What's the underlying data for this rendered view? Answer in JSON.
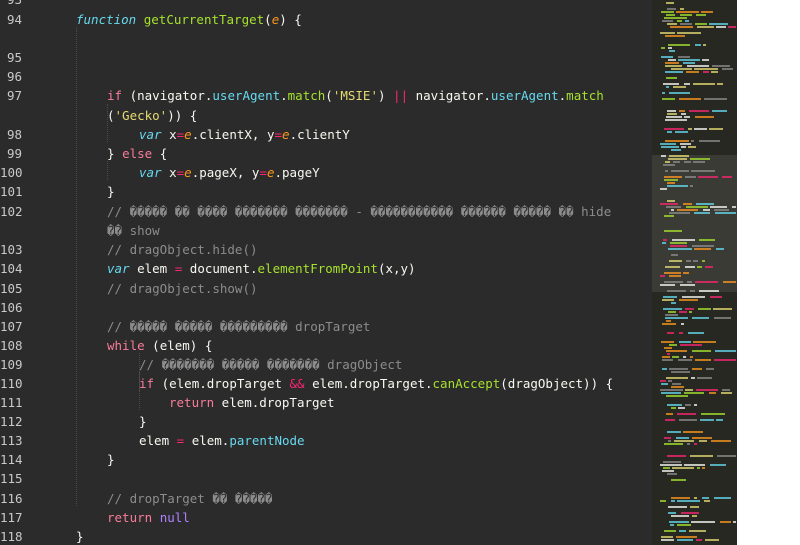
{
  "colors": {
    "background": "#2b2b2b",
    "line_number": "#c9c9c9",
    "keyword": "#f97b9b",
    "storage": "#66d9ef",
    "function": "#a6e22e",
    "parameter": "#fd971f",
    "string": "#e6db74",
    "property": "#66d9ef",
    "operator": "#f92672",
    "comment": "#8c8c8c",
    "text": "#f8f8f2",
    "bracket": "#ffd700",
    "literal": "#ae81ff",
    "minimap_bg": "#272822"
  },
  "line_numbers": [
    "93",
    "94",
    "95",
    "96",
    "97",
    "98",
    "99",
    "100",
    "101",
    "102",
    "103",
    "104",
    "105",
    "106",
    "107",
    "108",
    "109",
    "110",
    "111",
    "112",
    "113",
    "114",
    "115",
    "116",
    "117",
    "118"
  ],
  "code_lines": [
    [],
    [
      {
        "c": "kwi",
        "t": "function"
      },
      {
        "c": "pn",
        "t": " "
      },
      {
        "c": "fn",
        "t": "getCurrentTarget"
      },
      {
        "c": "pn",
        "t": "("
      },
      {
        "c": "prm",
        "t": "e"
      },
      {
        "c": "pn",
        "t": ") {"
      }
    ],
    [],
    [],
    [
      {
        "c": "kw",
        "t": "if"
      },
      {
        "c": "pn",
        "t": " ("
      },
      {
        "c": "pn",
        "t": "navigator."
      },
      {
        "c": "prop",
        "t": "userAgent"
      },
      {
        "c": "pn",
        "t": "."
      },
      {
        "c": "fn",
        "t": "match"
      },
      {
        "c": "pn",
        "t": "("
      },
      {
        "c": "str",
        "t": "'MSIE'"
      },
      {
        "c": "pn",
        "t": ") "
      },
      {
        "c": "op",
        "t": "||"
      },
      {
        "c": "pn",
        "t": " navigator."
      },
      {
        "c": "prop",
        "t": "userAgent"
      },
      {
        "c": "pn",
        "t": "."
      },
      {
        "c": "fn",
        "t": "match"
      }
    ],
    [
      {
        "c": "pn",
        "t": "("
      },
      {
        "c": "str",
        "t": "'Gecko'"
      },
      {
        "c": "pn",
        "t": ")) {"
      }
    ],
    [
      {
        "c": "kwi",
        "t": "var"
      },
      {
        "c": "pn",
        "t": " x"
      },
      {
        "c": "op",
        "t": "="
      },
      {
        "c": "prm",
        "t": "e"
      },
      {
        "c": "pn",
        "t": ".clientX, y"
      },
      {
        "c": "op",
        "t": "="
      },
      {
        "c": "prm",
        "t": "e"
      },
      {
        "c": "pn",
        "t": ".clientY"
      }
    ],
    [
      {
        "c": "pn",
        "t": "} "
      },
      {
        "c": "kw",
        "t": "else"
      },
      {
        "c": "pn",
        "t": " {"
      }
    ],
    [
      {
        "c": "kwi",
        "t": "var"
      },
      {
        "c": "pn",
        "t": " x"
      },
      {
        "c": "op",
        "t": "="
      },
      {
        "c": "prm",
        "t": "e"
      },
      {
        "c": "pn",
        "t": ".pageX, y"
      },
      {
        "c": "op",
        "t": "="
      },
      {
        "c": "prm",
        "t": "e"
      },
      {
        "c": "pn",
        "t": ".pageY"
      }
    ],
    [
      {
        "c": "pn",
        "t": "}"
      }
    ],
    [
      {
        "c": "cm",
        "t": "// ����� �� ���� ������� ������� - ����������� ������ ����� �� hide"
      }
    ],
    [
      {
        "c": "cm",
        "t": "�� show"
      }
    ],
    [
      {
        "c": "cm",
        "t": "// dragObject.hide()"
      }
    ],
    [
      {
        "c": "kwi",
        "t": "var"
      },
      {
        "c": "pn",
        "t": " elem "
      },
      {
        "c": "op",
        "t": "="
      },
      {
        "c": "pn",
        "t": " document."
      },
      {
        "c": "fn",
        "t": "elementFromPoint"
      },
      {
        "c": "pn",
        "t": "(x,y)"
      }
    ],
    [
      {
        "c": "cm",
        "t": "// dragObject.show()"
      }
    ],
    [],
    [
      {
        "c": "cm",
        "t": "// ����� ����� ��������� dropTarget"
      }
    ],
    [
      {
        "c": "kw",
        "t": "while"
      },
      {
        "c": "pn",
        "t": " (elem) {"
      }
    ],
    [
      {
        "c": "cm",
        "t": "// ������� ����� ������� dragObject"
      }
    ],
    [
      {
        "c": "kw",
        "t": "if"
      },
      {
        "c": "pn",
        "t": " (elem.dropTarget "
      },
      {
        "c": "op",
        "t": "&&"
      },
      {
        "c": "pn",
        "t": " elem.dropTarget."
      },
      {
        "c": "fn",
        "t": "canAccept"
      },
      {
        "c": "pn",
        "t": "(dragObject)) {"
      }
    ],
    [
      {
        "c": "kw",
        "t": "return"
      },
      {
        "c": "pn",
        "t": " elem.dropTarget"
      }
    ],
    [
      {
        "c": "pn",
        "t": "}"
      }
    ],
    [
      {
        "c": "pn",
        "t": "elem "
      },
      {
        "c": "op",
        "t": "="
      },
      {
        "c": "pn",
        "t": " elem."
      },
      {
        "c": "prop",
        "t": "parentNode"
      }
    ],
    [
      {
        "c": "pn",
        "t": "}"
      }
    ],
    [],
    [
      {
        "c": "cm",
        "t": "// dropTarget �� �����"
      }
    ],
    [
      {
        "c": "kw",
        "t": "return"
      },
      {
        "c": "pn",
        "t": " "
      },
      {
        "c": "lit",
        "t": "null"
      }
    ],
    [
      {
        "c": "pn",
        "t": "}"
      }
    ]
  ]
}
